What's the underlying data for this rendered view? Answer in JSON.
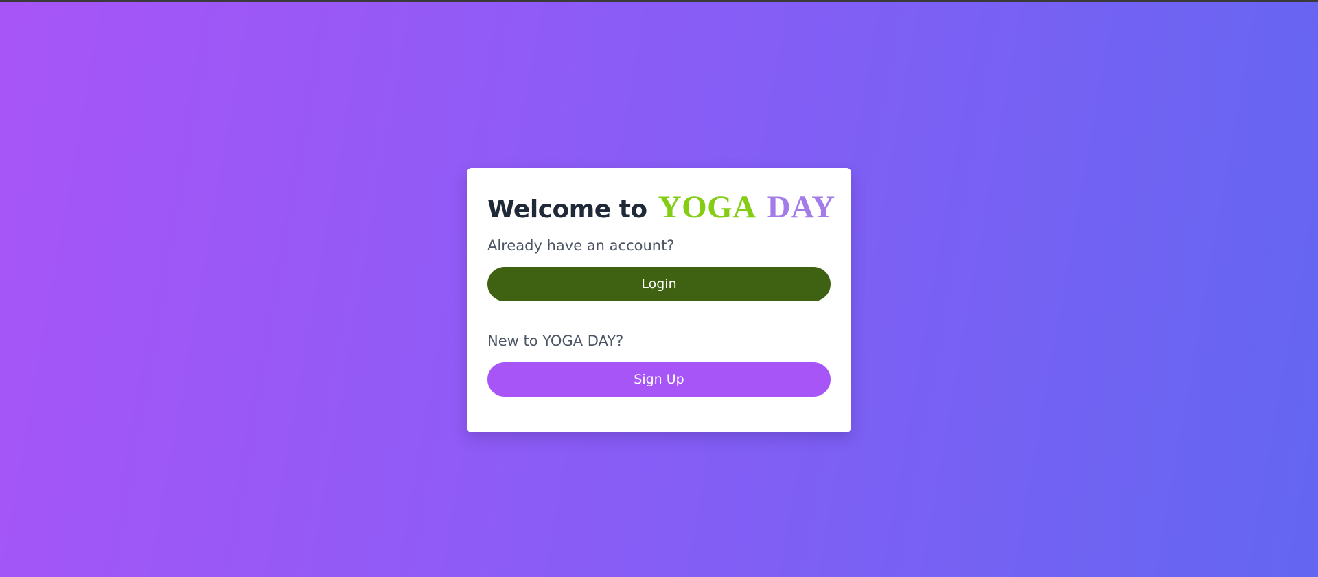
{
  "welcome": {
    "title_prefix": "Welcome to",
    "brand_first": "YOGA",
    "brand_second": "DAY"
  },
  "login_section": {
    "prompt": "Already have an account?",
    "button_label": "Login"
  },
  "signup_section": {
    "prompt": "New to YOGA DAY?",
    "button_label": "Sign Up"
  },
  "colors": {
    "brand_green": "#84cc16",
    "brand_purple": "#a47ce8",
    "login_button": "#3f6212",
    "signup_button": "#a855f7"
  }
}
